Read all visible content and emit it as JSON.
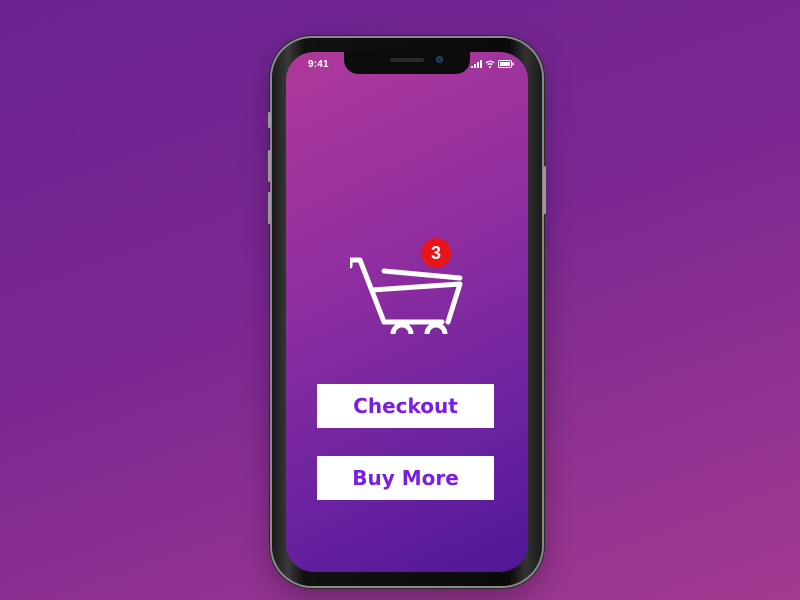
{
  "status_bar": {
    "time": "9:41",
    "icons": [
      "signal-icon",
      "wifi-icon",
      "battery-icon"
    ]
  },
  "cart": {
    "icon": "shopping-cart-icon",
    "badge_count": "3",
    "badge_color": "#e8141c"
  },
  "actions": {
    "checkout_label": "Checkout",
    "buy_more_label": "Buy More"
  },
  "colors": {
    "button_text": "#7a1ee0",
    "button_bg": "#ffffff"
  }
}
